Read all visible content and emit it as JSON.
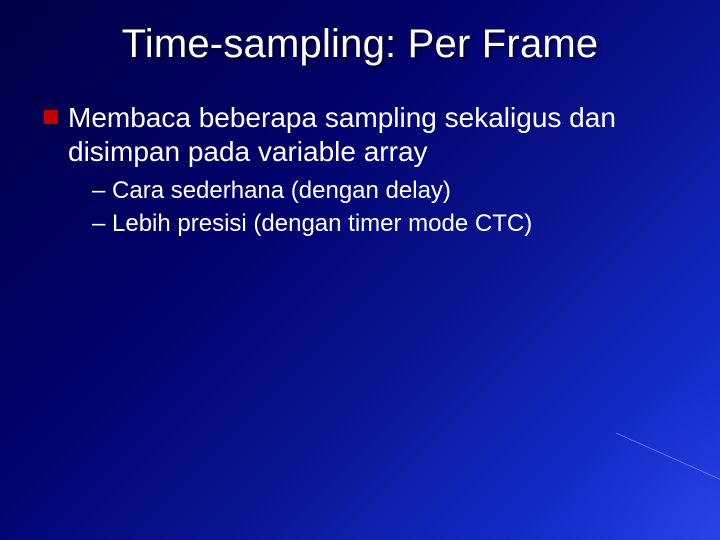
{
  "slide": {
    "title": "Time-sampling: Per Frame",
    "bullets": [
      {
        "text": "Membaca beberapa sampling sekaligus dan disimpan pada variable array",
        "sub": [
          "– Cara sederhana (dengan delay)",
          "– Lebih presisi (dengan timer mode CTC)"
        ]
      }
    ]
  }
}
